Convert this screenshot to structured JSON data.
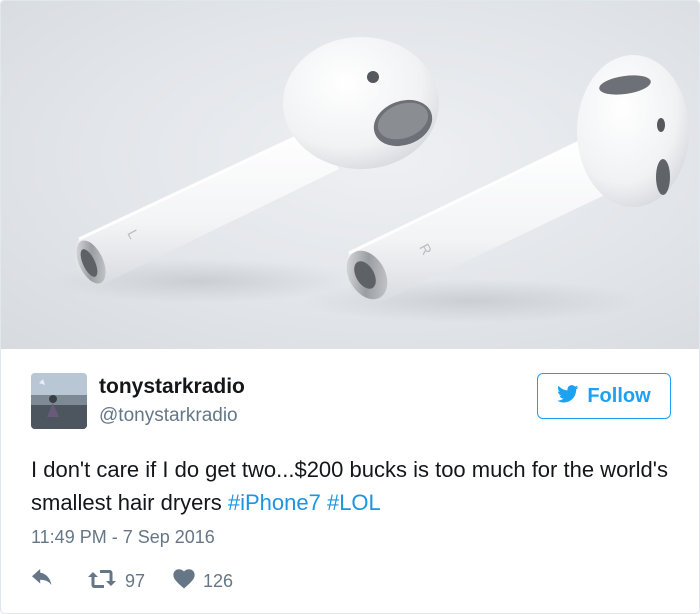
{
  "media": {
    "image_icon": "airpods-photo",
    "left_earbud_mark": "L",
    "right_earbud_mark": "R"
  },
  "user": {
    "display_name": "tonystarkradio",
    "handle": "@tonystarkradio",
    "avatar_icon": "profile-photo"
  },
  "follow": {
    "label": "Follow",
    "icon": "twitter-bird-icon",
    "color": "#1da1f2"
  },
  "tweet": {
    "text_main": "I don't care if I do get two...$200 bucks is too much for the world's smallest hair dryers",
    "hashtags": [
      "#iPhone7",
      "#LOL"
    ],
    "hashtag_color": "#1b95e0"
  },
  "timestamp": "11:49 PM - 7 Sep 2016",
  "actions": {
    "reply_icon": "reply-icon",
    "retweet_icon": "retweet-icon",
    "retweet_count": "97",
    "like_icon": "heart-icon",
    "like_count": "126"
  },
  "colors": {
    "secondary_text": "#657786",
    "border": "#e1e8ed"
  }
}
